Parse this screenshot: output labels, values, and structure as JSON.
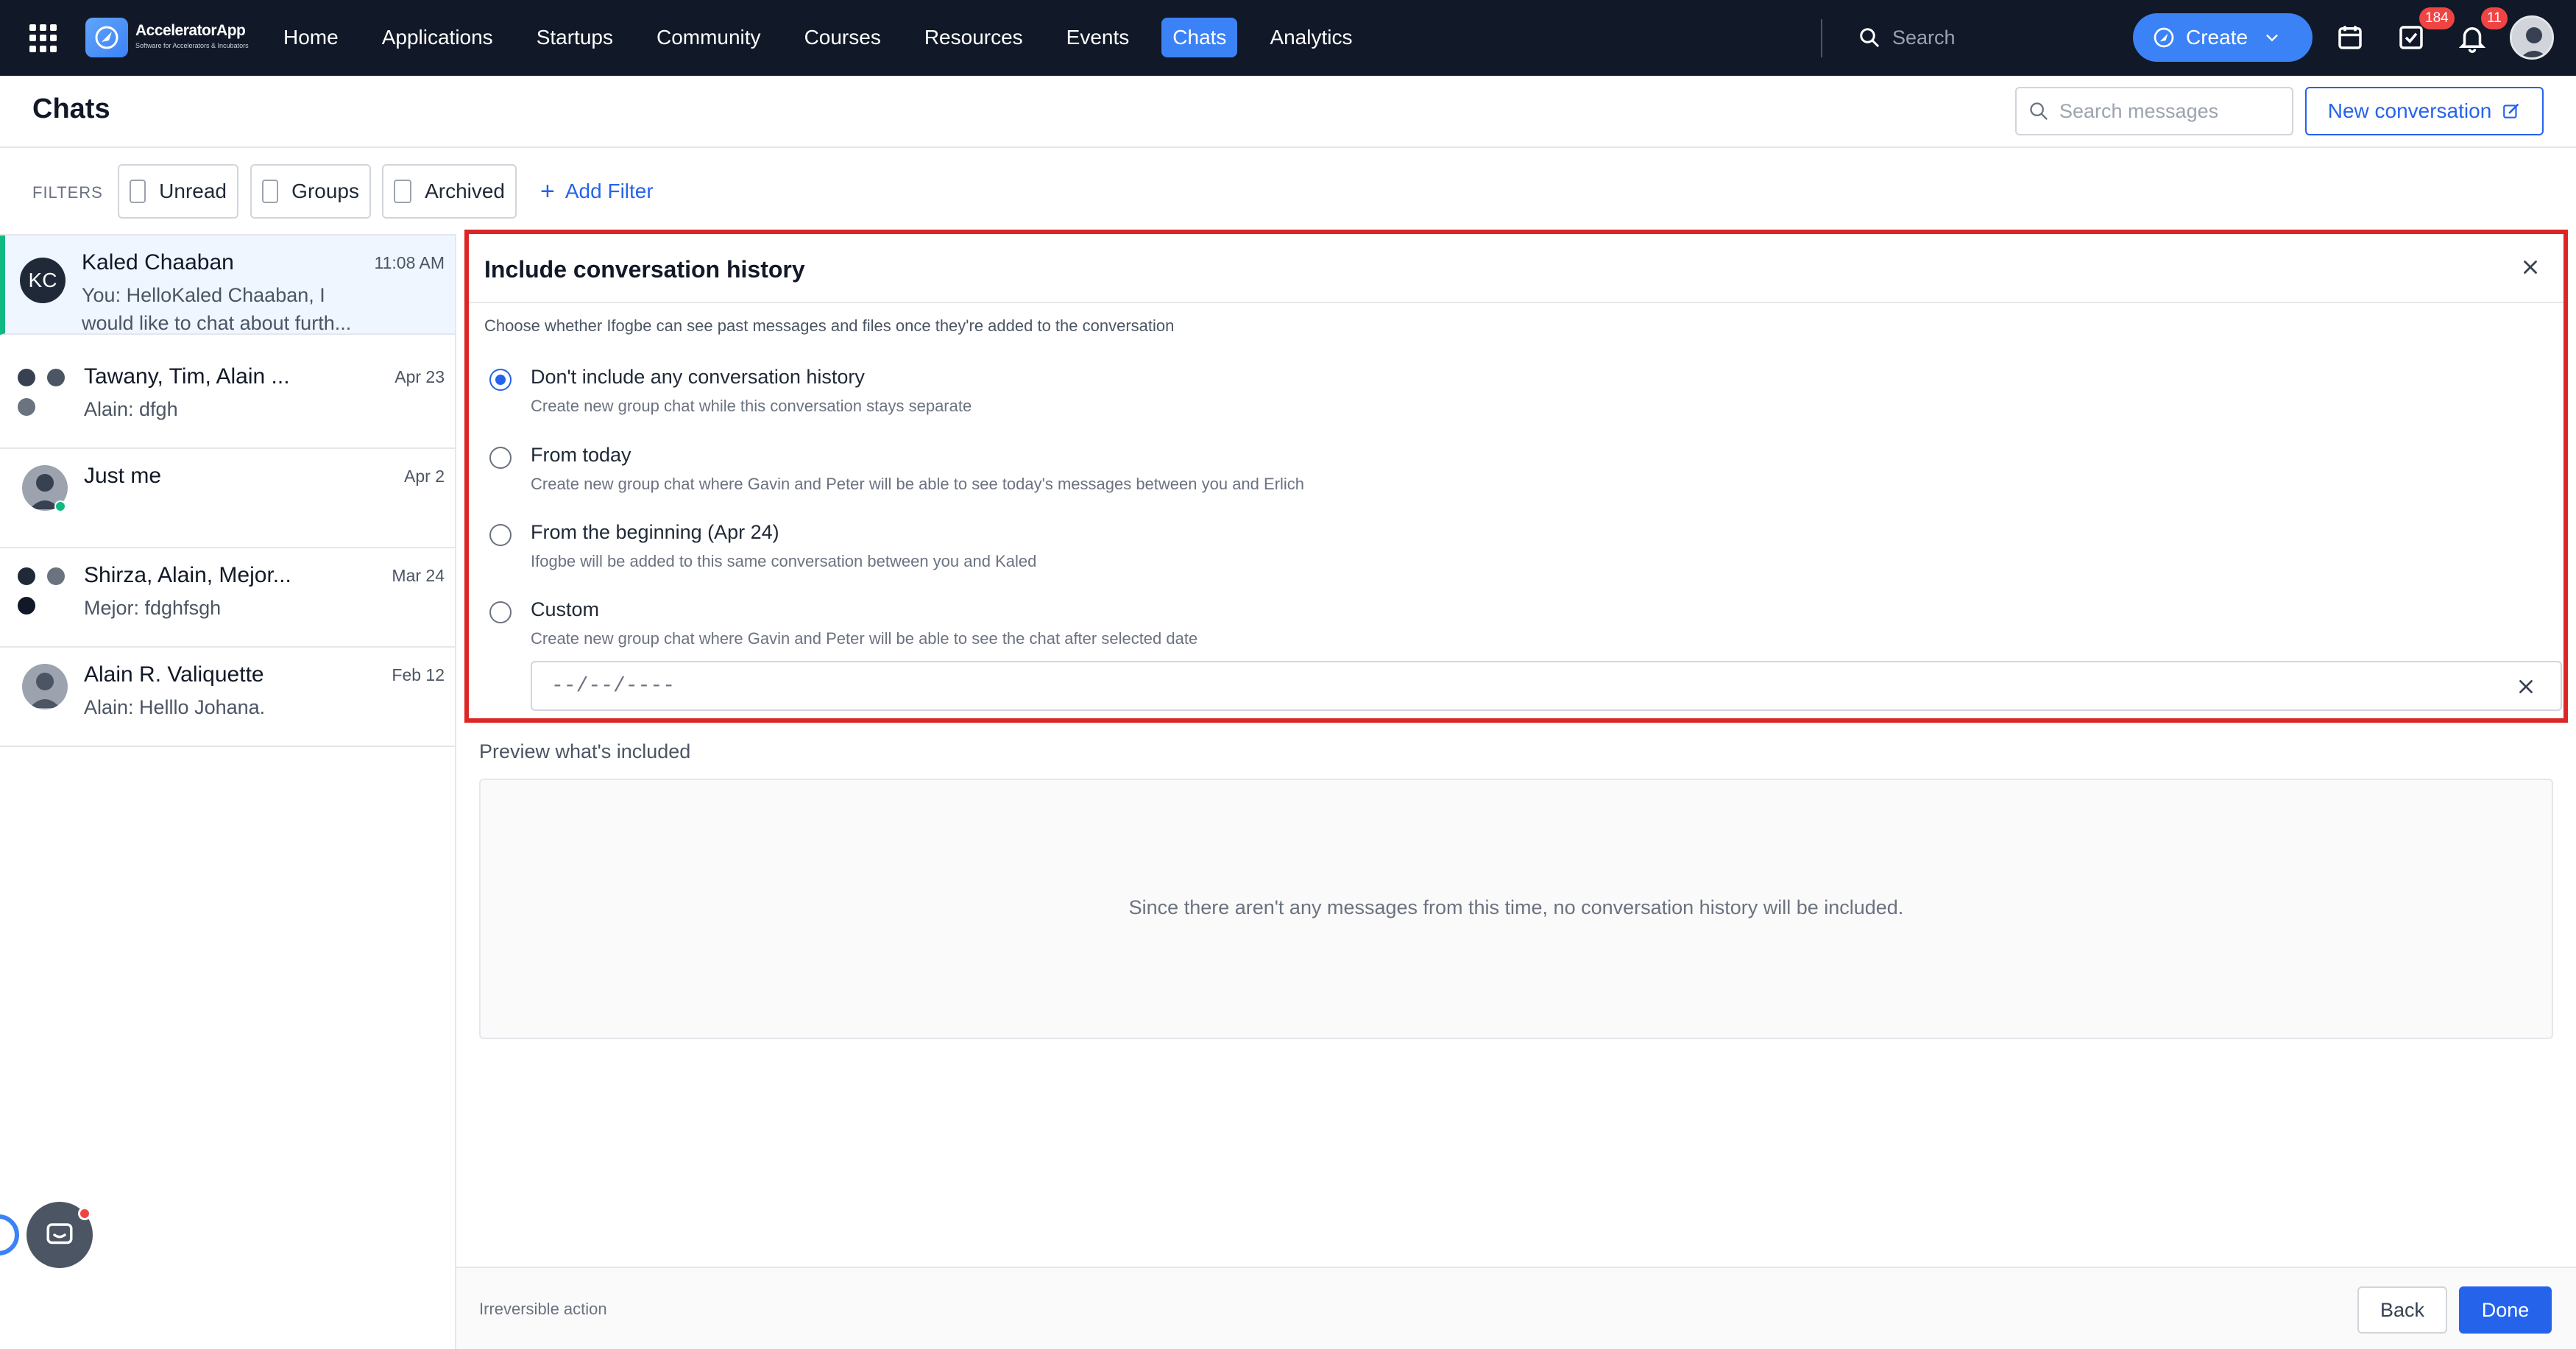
{
  "brand": {
    "name": "AcceleratorApp",
    "tagline": "Software for Accelerators & Incubators"
  },
  "nav": {
    "links": [
      "Home",
      "Applications",
      "Startups",
      "Community",
      "Courses",
      "Resources",
      "Events",
      "Chats",
      "Analytics"
    ],
    "active": "Chats",
    "search_placeholder": "Search",
    "create_label": "Create",
    "tasks_badge": "184",
    "notifications_badge": "11"
  },
  "header": {
    "title": "Chats",
    "search_placeholder": "Search messages",
    "new_conversation_label": "New conversation"
  },
  "filters": {
    "label": "FILTERS",
    "chips": [
      "Unread",
      "Groups",
      "Archived"
    ],
    "add_label": "Add Filter"
  },
  "conversations": [
    {
      "name": "Kaled Chaaban",
      "time": "11:08 AM",
      "preview": "You: HelloKaled Chaaban, I would like to chat about furth...",
      "initials": "KC"
    },
    {
      "name": "Tawany, Tim, Alain ...",
      "time": "Apr 23",
      "preview": "Alain: dfgh"
    },
    {
      "name": "Just me",
      "time": "Apr 2",
      "preview": ""
    },
    {
      "name": "Shirza, Alain, Mejor...",
      "time": "Mar 24",
      "preview": "Mejor: fdghfsgh"
    },
    {
      "name": "Alain R. Valiquette",
      "time": "Feb 12",
      "preview": "Alain: Helllo Johana."
    }
  ],
  "dialog": {
    "title": "Include conversation history",
    "description": "Choose whether Ifogbe can see past messages and files once they're added to the conversation",
    "options": [
      {
        "label": "Don't include any conversation history",
        "sub": "Create new group chat while this conversation stays separate",
        "checked": true
      },
      {
        "label": "From today",
        "sub": "Create new group chat where Gavin and Peter will be able to see today's messages between you and Erlich",
        "checked": false
      },
      {
        "label": "From the beginning (Apr 24)",
        "sub": "Ifogbe will be added to this same conversation between you and Kaled",
        "checked": false
      },
      {
        "label": "Custom",
        "sub": "Create new group chat where Gavin and Peter will be able to see the chat after selected date",
        "checked": false
      }
    ],
    "date_placeholder": "--/--/----"
  },
  "preview": {
    "label": "Preview what's included",
    "empty_text": "Since there aren't any messages from this time, no conversation history will be included."
  },
  "footer": {
    "note": "Irreversible action",
    "back_label": "Back",
    "done_label": "Done"
  },
  "colors": {
    "accent": "#2563eb",
    "nav_bg": "#111827",
    "highlight_border": "#dc2626",
    "active_marker": "#10b981"
  }
}
